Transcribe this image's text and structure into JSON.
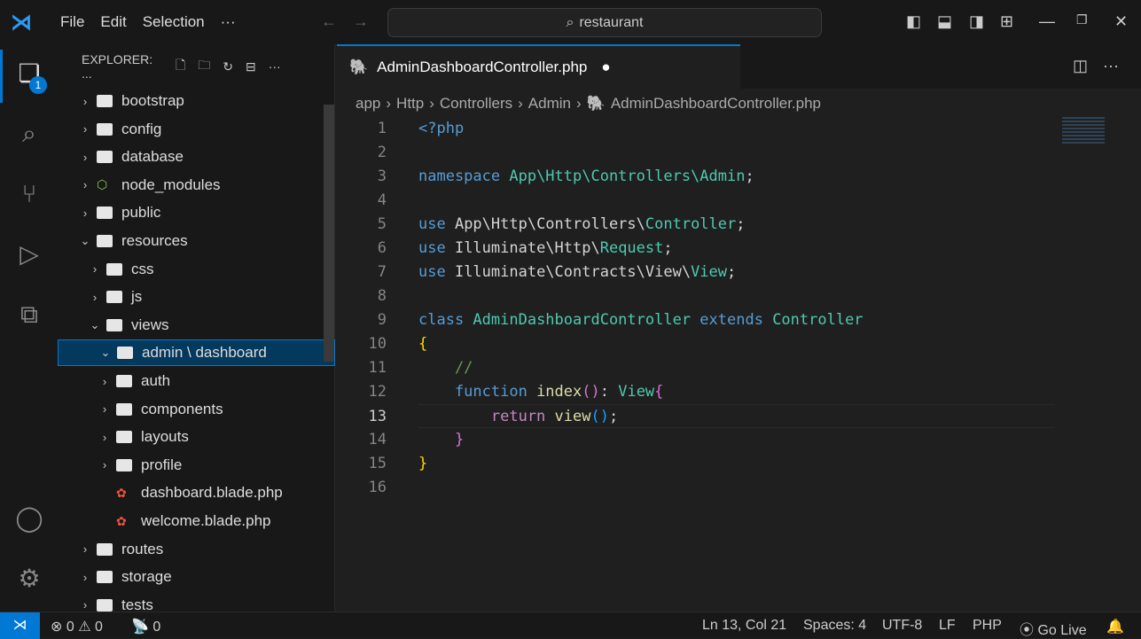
{
  "menu": [
    "File",
    "Edit",
    "Selection",
    "···"
  ],
  "search": "restaurant",
  "explorer": {
    "title": "EXPLORER: ...",
    "tree": [
      {
        "label": "bootstrap",
        "depth": 0,
        "type": "folder",
        "open": false
      },
      {
        "label": "config",
        "depth": 0,
        "type": "folder",
        "open": false
      },
      {
        "label": "database",
        "depth": 0,
        "type": "folder",
        "open": false
      },
      {
        "label": "node_modules",
        "depth": 0,
        "type": "node",
        "open": false
      },
      {
        "label": "public",
        "depth": 0,
        "type": "folder",
        "open": false
      },
      {
        "label": "resources",
        "depth": 0,
        "type": "folder",
        "open": true
      },
      {
        "label": "css",
        "depth": 1,
        "type": "folder",
        "open": false
      },
      {
        "label": "js",
        "depth": 1,
        "type": "folder",
        "open": false
      },
      {
        "label": "views",
        "depth": 1,
        "type": "folder",
        "open": true
      },
      {
        "label": "admin \\ dashboard",
        "depth": 2,
        "type": "folder",
        "open": true,
        "selected": true
      },
      {
        "label": "auth",
        "depth": 2,
        "type": "folder",
        "open": false
      },
      {
        "label": "components",
        "depth": 2,
        "type": "folder",
        "open": false
      },
      {
        "label": "layouts",
        "depth": 2,
        "type": "folder",
        "open": false
      },
      {
        "label": "profile",
        "depth": 2,
        "type": "folder",
        "open": false
      },
      {
        "label": "dashboard.blade.php",
        "depth": 2,
        "type": "blade"
      },
      {
        "label": "welcome.blade.php",
        "depth": 2,
        "type": "blade"
      },
      {
        "label": "routes",
        "depth": 0,
        "type": "folder",
        "open": false
      },
      {
        "label": "storage",
        "depth": 0,
        "type": "folder",
        "open": false
      },
      {
        "label": "tests",
        "depth": 0,
        "type": "folder",
        "open": false
      }
    ]
  },
  "activity_badge": "1",
  "tab": {
    "label": "AdminDashboardController.php",
    "modified": "●"
  },
  "breadcrumb": [
    "app",
    "Http",
    "Controllers",
    "Admin",
    "AdminDashboardController.php"
  ],
  "code": [
    [
      [
        "<?php",
        "#569cd6"
      ]
    ],
    [],
    [
      [
        "namespace ",
        "#569cd6"
      ],
      [
        "App\\Http\\Controllers\\Admin",
        "#4ec9b0"
      ],
      [
        ";",
        "#d4d4d4"
      ]
    ],
    [],
    [
      [
        "use ",
        "#569cd6"
      ],
      [
        "App\\Http\\Controllers\\",
        "#d4d4d4"
      ],
      [
        "Controller",
        "#4ec9b0"
      ],
      [
        ";",
        "#d4d4d4"
      ]
    ],
    [
      [
        "use ",
        "#569cd6"
      ],
      [
        "Illuminate\\Http\\",
        "#d4d4d4"
      ],
      [
        "Request",
        "#4ec9b0"
      ],
      [
        ";",
        "#d4d4d4"
      ]
    ],
    [
      [
        "use ",
        "#569cd6"
      ],
      [
        "Illuminate\\Contracts\\View\\",
        "#d4d4d4"
      ],
      [
        "View",
        "#4ec9b0"
      ],
      [
        ";",
        "#d4d4d4"
      ]
    ],
    [],
    [
      [
        "class ",
        "#569cd6"
      ],
      [
        "AdminDashboardController ",
        "#4ec9b0"
      ],
      [
        "extends ",
        "#569cd6"
      ],
      [
        "Controller",
        "#4ec9b0"
      ]
    ],
    [
      [
        "{",
        "#ffd700"
      ]
    ],
    [
      [
        "    //",
        "#6a9955"
      ]
    ],
    [
      [
        "    function ",
        "#569cd6"
      ],
      [
        "index",
        "#dcdcaa"
      ],
      [
        "()",
        "#da70d6"
      ],
      [
        ": ",
        "#d4d4d4"
      ],
      [
        "View",
        "#4ec9b0"
      ],
      [
        "{",
        "#da70d6"
      ]
    ],
    [
      [
        "        return ",
        "#c586c0"
      ],
      [
        "view",
        "#dcdcaa"
      ],
      [
        "()",
        "#179fff"
      ],
      [
        ";",
        "#d4d4d4"
      ]
    ],
    [
      [
        "    }",
        "#da70d6"
      ]
    ],
    [
      [
        "}",
        "#ffd700"
      ]
    ],
    []
  ],
  "current_line": 13,
  "status": {
    "errors": "0",
    "warnings": "0",
    "ports": "0",
    "position": "Ln 13, Col 21",
    "spaces": "Spaces: 4",
    "encoding": "UTF-8",
    "eol": "LF",
    "language": "PHP",
    "golive": "Go Live"
  }
}
